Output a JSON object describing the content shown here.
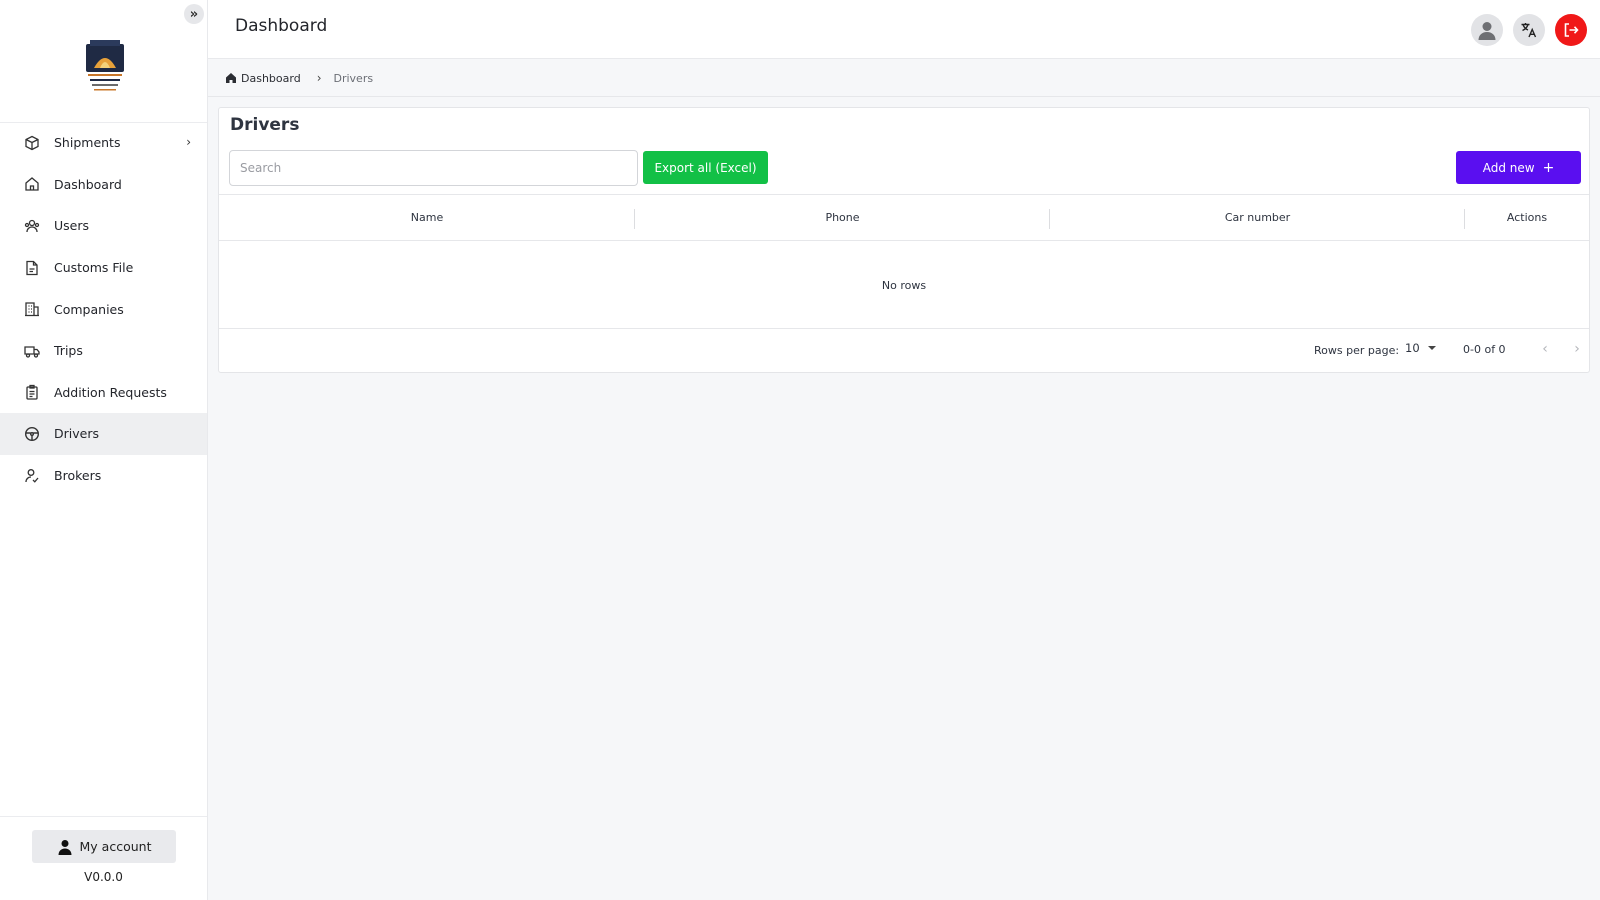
{
  "header": {
    "title": "Dashboard"
  },
  "sidebar": {
    "items": [
      {
        "label": "Shipments",
        "icon": "box-icon"
      },
      {
        "label": "Dashboard",
        "icon": "home-icon"
      },
      {
        "label": "Users",
        "icon": "users-icon"
      },
      {
        "label": "Customs File",
        "icon": "file-icon"
      },
      {
        "label": "Companies",
        "icon": "building-icon"
      },
      {
        "label": "Trips",
        "icon": "truck-icon"
      },
      {
        "label": "Addition Requests",
        "icon": "clipboard-icon"
      },
      {
        "label": "Drivers",
        "icon": "steering-wheel-icon"
      },
      {
        "label": "Brokers",
        "icon": "broker-icon"
      }
    ],
    "active": "Drivers",
    "account_label": "My account",
    "version": "V0.0.0"
  },
  "breadcrumb": {
    "home": "Dashboard",
    "current": "Drivers"
  },
  "page": {
    "title": "Drivers",
    "search_placeholder": "Search",
    "export_label": "Export all (Excel)",
    "add_label": "Add new",
    "add_plus": "+"
  },
  "table": {
    "columns": [
      "Name",
      "Phone",
      "Car number",
      "Actions"
    ],
    "empty_text": "No rows",
    "rows_per_page_label": "Rows per page:",
    "rows_per_page_value": "10",
    "range_text": "0-0 of 0"
  },
  "colors": {
    "export": "#12c046",
    "add": "#5a0ff0",
    "logout": "#f01818",
    "active_nav": "#eeeff1"
  }
}
